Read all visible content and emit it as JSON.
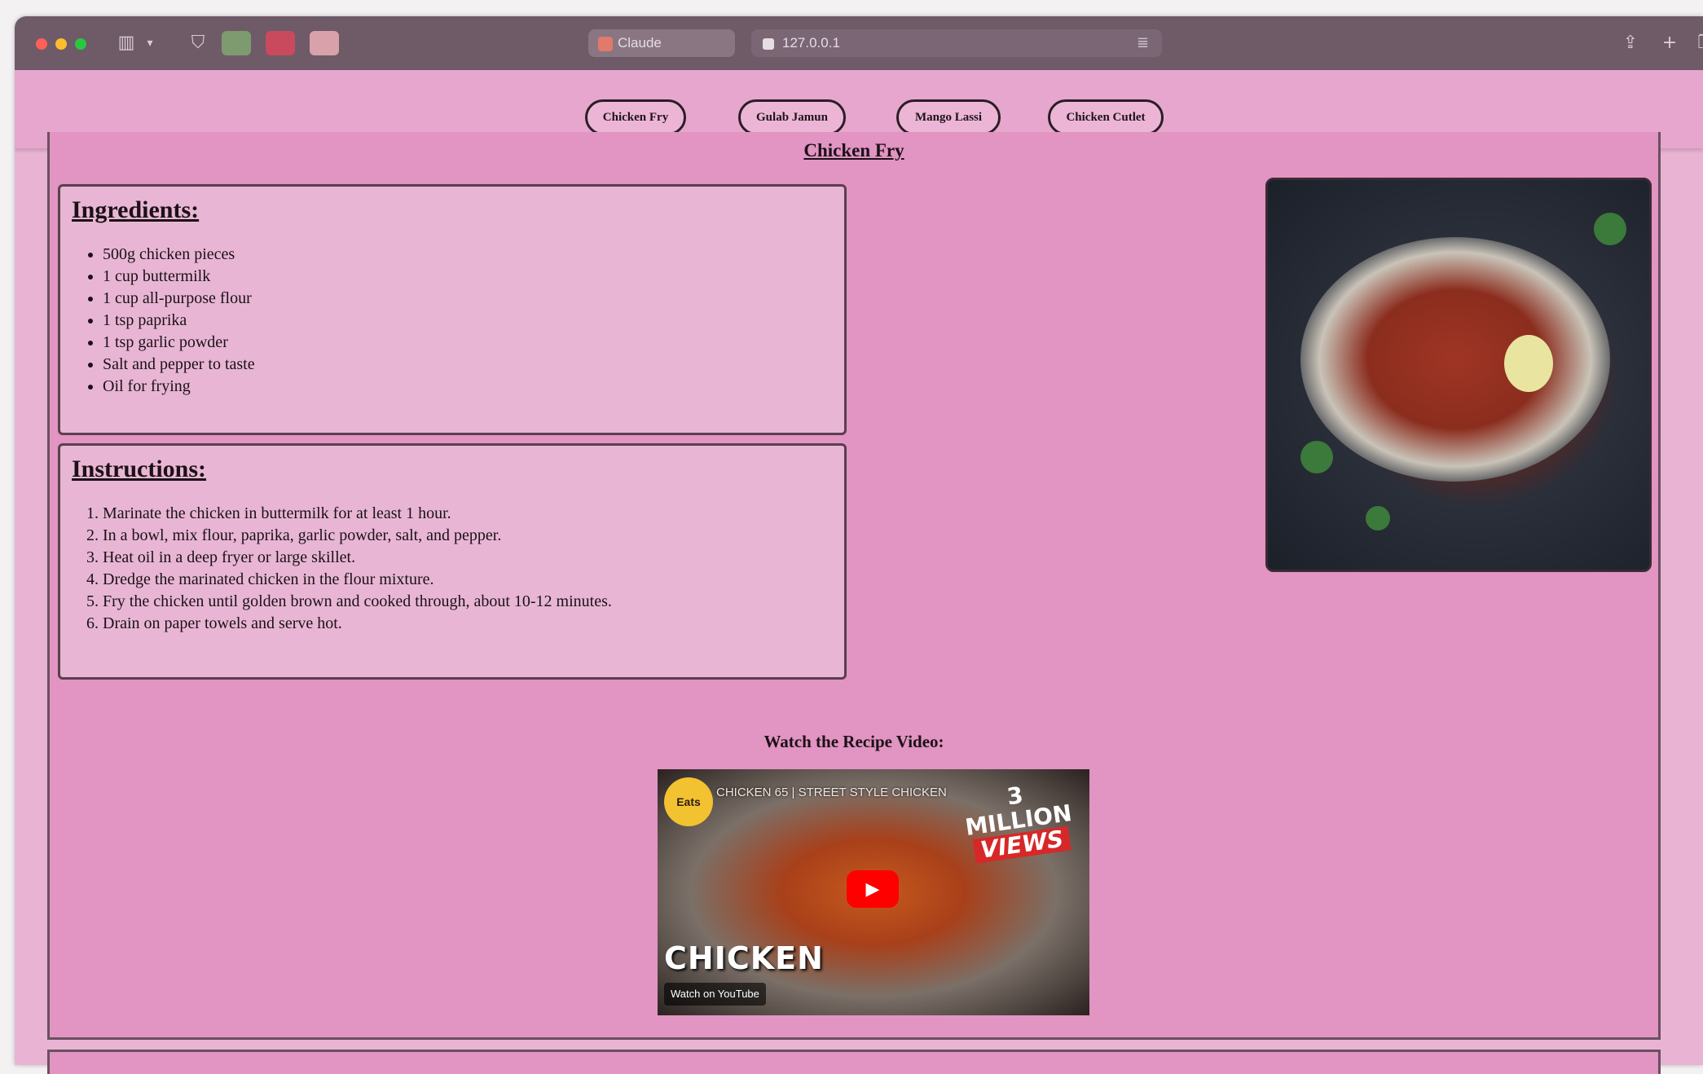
{
  "browser": {
    "tab_title": "Claude",
    "address": "127.0.0.1",
    "icons": [
      "sidebar-icon",
      "chevron-down-icon",
      "shield-icon",
      "extension-icon",
      "share-icon",
      "plus-icon",
      "tabs-icon"
    ]
  },
  "nav": {
    "items": [
      "Chicken Fry",
      "Gulab Jamun",
      "Mango Lassi",
      "Chicken Cutlet"
    ]
  },
  "recipe": {
    "title": "Chicken Fry",
    "ingredients_heading": "Ingredients:",
    "ingredients": [
      "500g chicken pieces",
      "1 cup buttermilk",
      "1 cup all-purpose flour",
      "1 tsp paprika",
      "1 tsp garlic powder",
      "Salt and pepper to taste",
      "Oil for frying"
    ],
    "instructions_heading": "Instructions:",
    "instructions": [
      "Marinate the chicken in buttermilk for at least 1 hour.",
      "In a bowl, mix flour, paprika, garlic powder, salt, and pepper.",
      "Heat oil in a deep fryer or large skillet.",
      "Dredge the marinated chicken in the flour mixture.",
      "Fry the chicken until golden brown and cooked through, about 10-12 minutes.",
      "Drain on paper towels and serve hot."
    ],
    "video_label": "Watch the Recipe Video:",
    "video": {
      "badge": "Eats",
      "title": "CHICKEN 65 | STREET STYLE CHICKEN",
      "views_line1": "3 MILLION",
      "views_line2": "VIEWS",
      "overlay_text": "CHICKEN",
      "watch_on": "Watch on YouTube"
    }
  },
  "colors": {
    "page_bg": "#e294c2",
    "nav_bg": "#e6a6cd",
    "card_bg": "#e8b6d4",
    "chrome_bg": "#6f5a68"
  }
}
